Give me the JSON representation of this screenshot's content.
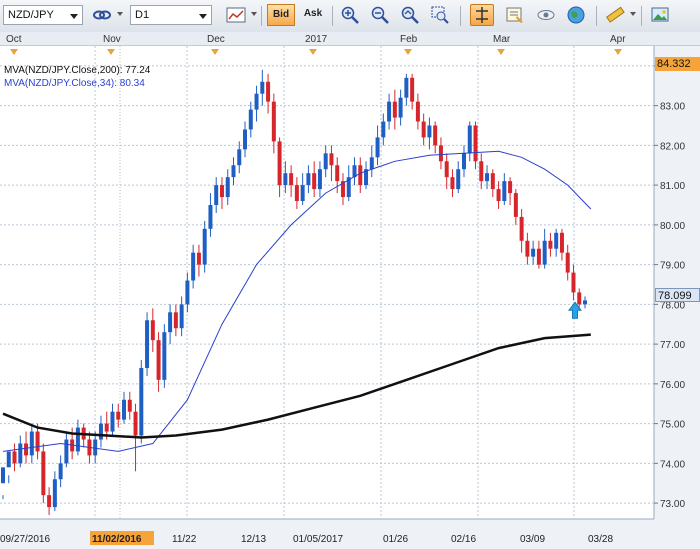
{
  "toolbar": {
    "symbol": "NZD/JPY",
    "timeframe": "D1",
    "bid_label": "Bid",
    "ask_label": "Ask",
    "icons": [
      "link-icon",
      "candlestick-chart-icon",
      "zoom-in-icon",
      "zoom-out-icon",
      "zoom-fit-icon",
      "zoom-select-icon",
      "crosshair-icon",
      "properties-icon",
      "eye-icon",
      "globe-icon",
      "ruler-icon",
      "save-image-icon"
    ]
  },
  "legend": {
    "ma200": "MVA(NZD/JPY.Close,200): 77.24",
    "ma34": "MVA(NZD/JPY.Close,34): 80.34"
  },
  "price": {
    "high_badge": "84.332",
    "last_badge": "78.099"
  },
  "colors": {
    "bull": "#1f5fc4",
    "bear": "#d7262b",
    "ma34": "#2a3fd0",
    "ma200": "#111111",
    "grid": "#b9c7d8",
    "highlight": "#f6a43a"
  },
  "chart_data": {
    "type": "candlestick",
    "y_ticks": [
      "84.00",
      "83.00",
      "82.00",
      "81.00",
      "80.00",
      "79.00",
      "78.00",
      "77.00",
      "76.00",
      "75.00",
      "74.00",
      "73.00"
    ],
    "ylim": [
      72.6,
      84.5
    ],
    "top_months": [
      "Oct",
      "Nov",
      "Dec",
      "2017",
      "Feb",
      "Mar",
      "Apr"
    ],
    "bottom_dates": [
      "09/27/2016",
      "11/02/2016",
      "11/22",
      "12/13",
      "01/05/2017",
      "01/26",
      "02/16",
      "03/09",
      "03/28"
    ],
    "highlighted_date": "11/02/2016",
    "candles": [
      [
        73.5,
        73.9,
        73.2,
        73.1
      ],
      [
        73.9,
        74.3,
        73.7,
        73.5
      ],
      [
        74.3,
        74.0,
        73.8,
        74.5
      ],
      [
        74.0,
        74.5,
        73.9,
        74.7
      ],
      [
        74.5,
        74.2,
        74.0,
        74.8
      ],
      [
        74.2,
        74.8,
        74.0,
        75.0
      ],
      [
        74.8,
        74.3,
        74.1,
        75.0
      ],
      [
        74.3,
        73.2,
        73.0,
        74.5
      ],
      [
        73.2,
        72.9,
        72.7,
        73.4
      ],
      [
        72.9,
        73.6,
        72.8,
        73.8
      ],
      [
        73.6,
        74.0,
        73.4,
        74.2
      ],
      [
        74.0,
        74.6,
        73.9,
        74.8
      ],
      [
        74.6,
        74.3,
        74.1,
        74.9
      ],
      [
        74.3,
        74.9,
        74.2,
        75.1
      ],
      [
        74.9,
        74.6,
        74.4,
        75.0
      ],
      [
        74.6,
        74.2,
        74.0,
        74.8
      ],
      [
        74.2,
        74.6,
        74.0,
        74.8
      ],
      [
        74.6,
        75.0,
        74.4,
        75.2
      ],
      [
        75.0,
        74.8,
        74.6,
        75.3
      ],
      [
        74.8,
        75.3,
        74.7,
        75.5
      ],
      [
        75.3,
        75.1,
        74.9,
        75.5
      ],
      [
        75.1,
        75.6,
        75.0,
        75.8
      ],
      [
        75.6,
        75.3,
        75.1,
        75.8
      ],
      [
        75.3,
        74.7,
        73.8,
        75.5
      ],
      [
        74.7,
        76.4,
        74.5,
        76.6
      ],
      [
        76.4,
        77.6,
        76.2,
        77.8
      ],
      [
        77.6,
        77.1,
        76.8,
        77.9
      ],
      [
        77.1,
        76.1,
        75.8,
        77.3
      ],
      [
        76.1,
        77.3,
        75.9,
        77.5
      ],
      [
        77.3,
        77.8,
        77.0,
        78.0
      ],
      [
        77.8,
        77.4,
        77.2,
        78.0
      ],
      [
        77.4,
        78.0,
        77.2,
        78.2
      ],
      [
        78.0,
        78.6,
        77.8,
        78.8
      ],
      [
        78.6,
        79.3,
        78.4,
        79.5
      ],
      [
        79.3,
        79.0,
        78.7,
        79.5
      ],
      [
        79.0,
        79.9,
        78.8,
        80.1
      ],
      [
        79.9,
        80.5,
        79.7,
        80.8
      ],
      [
        80.5,
        81.0,
        80.3,
        81.2
      ],
      [
        81.0,
        80.7,
        80.4,
        81.2
      ],
      [
        80.7,
        81.2,
        80.5,
        81.4
      ],
      [
        81.2,
        81.5,
        81.0,
        81.7
      ],
      [
        81.5,
        81.9,
        81.3,
        82.1
      ],
      [
        81.9,
        82.4,
        81.7,
        82.6
      ],
      [
        82.4,
        82.9,
        82.2,
        83.1
      ],
      [
        82.9,
        83.3,
        82.6,
        83.5
      ],
      [
        83.3,
        83.6,
        83.0,
        83.9
      ],
      [
        83.6,
        83.1,
        82.8,
        83.8
      ],
      [
        83.1,
        82.1,
        81.8,
        83.3
      ],
      [
        82.1,
        81.0,
        80.7,
        82.2
      ],
      [
        81.0,
        81.3,
        80.8,
        81.6
      ],
      [
        81.3,
        81.0,
        80.7,
        81.5
      ],
      [
        81.0,
        80.6,
        80.4,
        81.2
      ],
      [
        80.6,
        81.0,
        80.5,
        81.3
      ],
      [
        81.0,
        81.3,
        80.8,
        81.5
      ],
      [
        81.3,
        80.9,
        80.7,
        81.6
      ],
      [
        80.9,
        81.4,
        80.7,
        81.6
      ],
      [
        81.4,
        81.8,
        81.2,
        82.0
      ],
      [
        81.8,
        81.5,
        81.1,
        82.0
      ],
      [
        81.5,
        81.1,
        80.8,
        81.7
      ],
      [
        81.1,
        80.7,
        80.5,
        81.3
      ],
      [
        80.7,
        81.2,
        80.6,
        81.5
      ],
      [
        81.2,
        81.5,
        81.0,
        81.7
      ],
      [
        81.5,
        81.0,
        80.8,
        81.7
      ],
      [
        81.0,
        81.4,
        80.9,
        81.6
      ],
      [
        81.4,
        81.7,
        81.2,
        82.0
      ],
      [
        81.7,
        82.2,
        81.5,
        82.5
      ],
      [
        82.2,
        82.6,
        82.0,
        82.8
      ],
      [
        82.6,
        83.1,
        82.4,
        83.3
      ],
      [
        83.1,
        82.7,
        82.4,
        83.4
      ],
      [
        82.7,
        83.2,
        82.5,
        83.4
      ],
      [
        83.2,
        83.7,
        83.0,
        83.8
      ],
      [
        83.7,
        83.1,
        82.9,
        83.8
      ],
      [
        83.1,
        82.6,
        82.4,
        83.3
      ],
      [
        82.6,
        82.2,
        82.0,
        82.8
      ],
      [
        82.2,
        82.5,
        81.9,
        82.7
      ],
      [
        82.5,
        82.0,
        81.8,
        82.6
      ],
      [
        82.0,
        81.6,
        81.4,
        82.2
      ],
      [
        81.6,
        81.2,
        80.9,
        81.8
      ],
      [
        81.2,
        80.9,
        80.7,
        81.4
      ],
      [
        80.9,
        81.4,
        80.8,
        81.6
      ],
      [
        81.4,
        81.8,
        81.2,
        82.0
      ],
      [
        81.8,
        82.5,
        81.6,
        82.6
      ],
      [
        82.5,
        81.6,
        81.4,
        82.6
      ],
      [
        81.6,
        81.1,
        80.9,
        81.8
      ],
      [
        81.1,
        81.3,
        80.9,
        81.5
      ],
      [
        81.3,
        80.9,
        80.7,
        81.4
      ],
      [
        80.9,
        80.6,
        80.4,
        81.1
      ],
      [
        80.6,
        81.1,
        80.5,
        81.3
      ],
      [
        81.1,
        80.8,
        80.5,
        81.2
      ],
      [
        80.8,
        80.2,
        80.0,
        80.9
      ],
      [
        80.2,
        79.6,
        79.3,
        80.4
      ],
      [
        79.6,
        79.2,
        79.0,
        79.8
      ],
      [
        79.2,
        79.4,
        79.0,
        79.6
      ],
      [
        79.4,
        79.0,
        78.9,
        79.6
      ],
      [
        79.0,
        79.6,
        78.9,
        79.9
      ],
      [
        79.6,
        79.4,
        79.2,
        79.8
      ],
      [
        79.4,
        79.8,
        79.2,
        79.9
      ],
      [
        79.8,
        79.3,
        79.1,
        79.9
      ],
      [
        79.3,
        78.8,
        78.6,
        79.5
      ],
      [
        78.8,
        78.3,
        78.1,
        79.0
      ],
      [
        78.3,
        78.0,
        77.9,
        78.4
      ],
      [
        78.0,
        78.1,
        77.9,
        78.2
      ]
    ],
    "ma34": [
      [
        0,
        74.3
      ],
      [
        10,
        74.5
      ],
      [
        20,
        74.3
      ],
      [
        26,
        74.5
      ],
      [
        32,
        75.6
      ],
      [
        38,
        77.5
      ],
      [
        44,
        79.0
      ],
      [
        50,
        80.0
      ],
      [
        56,
        80.8
      ],
      [
        62,
        81.3
      ],
      [
        68,
        81.6
      ],
      [
        74,
        81.75
      ],
      [
        80,
        81.8
      ],
      [
        86,
        81.85
      ],
      [
        90,
        81.7
      ],
      [
        94,
        81.4
      ],
      [
        98,
        81.0
      ],
      [
        102,
        80.4
      ]
    ],
    "ma200": [
      [
        0,
        75.25
      ],
      [
        6,
        74.9
      ],
      [
        12,
        74.75
      ],
      [
        18,
        74.7
      ],
      [
        24,
        74.65
      ],
      [
        30,
        74.7
      ],
      [
        38,
        74.85
      ],
      [
        46,
        75.1
      ],
      [
        54,
        75.4
      ],
      [
        62,
        75.7
      ],
      [
        70,
        76.1
      ],
      [
        78,
        76.5
      ],
      [
        86,
        76.9
      ],
      [
        94,
        77.15
      ],
      [
        102,
        77.24
      ]
    ]
  }
}
